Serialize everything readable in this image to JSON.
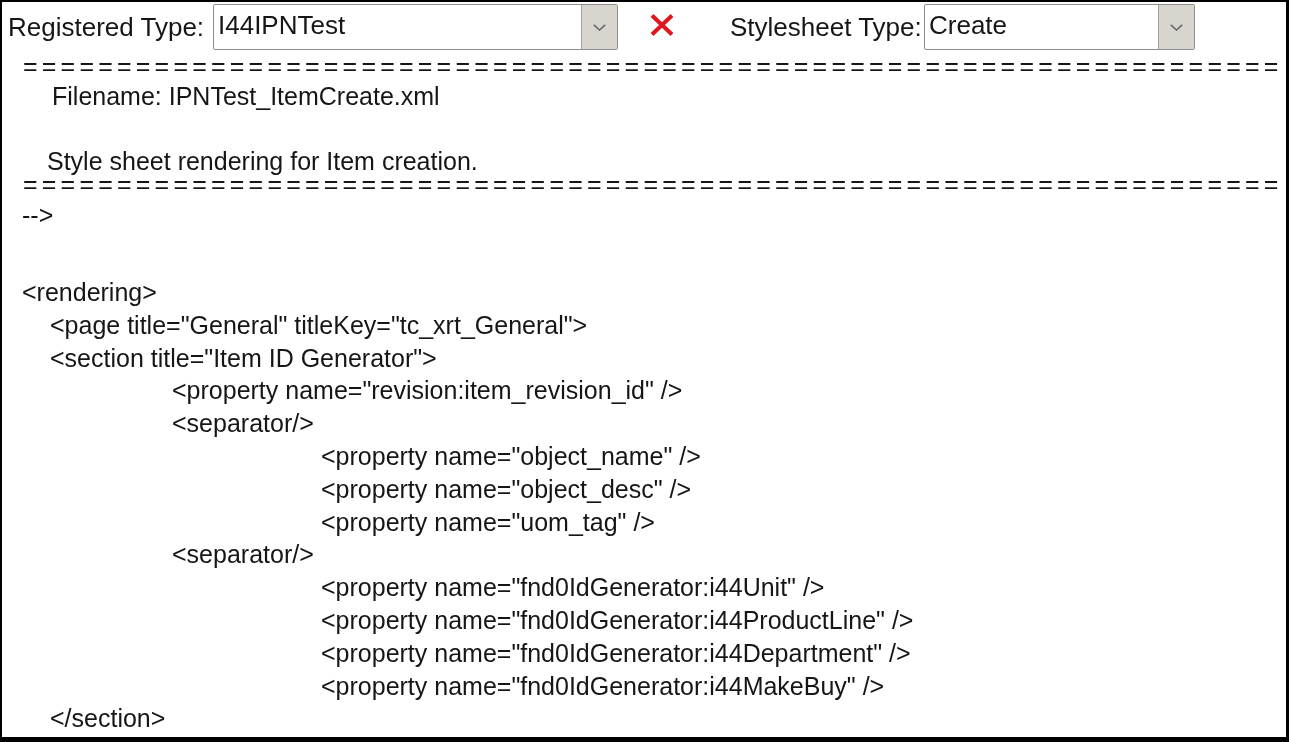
{
  "toolbar": {
    "registered_type": {
      "label": "Registered Type:",
      "value": "I44IPNTest"
    },
    "stylesheet_type": {
      "label": "Stylesheet Type:",
      "value": "Create"
    }
  },
  "comment": {
    "rule_top": "===================================================================",
    "lines": [
      "Filename: IPNTest_ItemCreate.xml",
      "Style sheet rendering for Item creation."
    ],
    "rule_bottom": "===================================================================",
    "close": "-->"
  },
  "xml": [
    {
      "text": "<rendering>",
      "children": [
        {
          "text": "<page title=\"General\" titleKey=\"tc_xrt_General\">"
        },
        {
          "text": "<section title=\"Item ID Generator\">",
          "children": [
            {
              "text": "<property name=\"revision:item_revision_id\" />"
            },
            {
              "text": "<separator/>",
              "children": [
                {
                  "text": "<property name=\"object_name\" />"
                },
                {
                  "text": "<property name=\"object_desc\" />"
                },
                {
                  "text": "<property name=\"uom_tag\" />"
                }
              ]
            },
            {
              "text": "<separator/>",
              "children": [
                {
                  "text": "<property name=\"fnd0IdGenerator:i44Unit\" />"
                },
                {
                  "text": "<property name=\"fnd0IdGenerator:i44ProductLine\" />"
                },
                {
                  "text": "<property name=\"fnd0IdGenerator:i44Department\" />"
                },
                {
                  "text": "<property name=\"fnd0IdGenerator:i44MakeBuy\" />"
                }
              ]
            }
          ]
        },
        {
          "text": "</section>"
        }
      ]
    }
  ]
}
